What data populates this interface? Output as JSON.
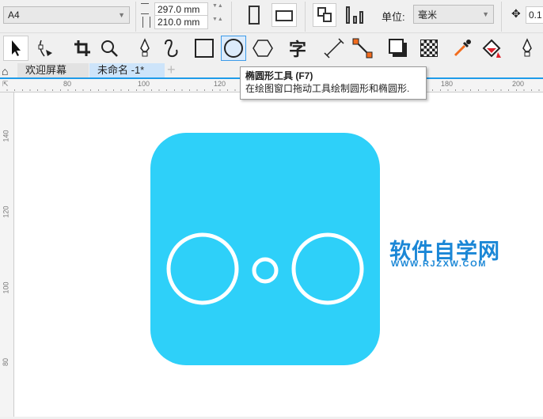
{
  "property_bar": {
    "page_size": "A4",
    "width": "297.0 mm",
    "height": "210.0 mm",
    "units_label": "单位:",
    "units_value": "毫米",
    "nudge": "0.1"
  },
  "toolbox": {
    "tools": [
      {
        "name": "pick-tool",
        "icon": "arrow-cursor-icon"
      },
      {
        "name": "shape-tool",
        "icon": "shape-node-icon"
      },
      {
        "name": "crop-tool",
        "icon": "crop-icon"
      },
      {
        "name": "zoom-tool",
        "icon": "magnifier-icon"
      },
      {
        "name": "freehand-tool",
        "icon": "pen-nib-icon"
      },
      {
        "name": "artistic-media-tool",
        "icon": "curve-icon"
      },
      {
        "name": "rectangle-tool",
        "icon": "rectangle-icon"
      },
      {
        "name": "ellipse-tool",
        "icon": "ellipse-icon",
        "active": true
      },
      {
        "name": "polygon-tool",
        "icon": "hexagon-icon"
      },
      {
        "name": "text-tool",
        "icon": "text-icon",
        "label": "字"
      },
      {
        "name": "dimension-tool",
        "icon": "dimension-icon"
      },
      {
        "name": "connector-tool",
        "icon": "connector-icon"
      },
      {
        "name": "drop-shadow-tool",
        "icon": "shadow-icon"
      },
      {
        "name": "transparency-tool",
        "icon": "checker-icon"
      },
      {
        "name": "eyedropper-tool",
        "icon": "eyedropper-icon"
      },
      {
        "name": "interactive-fill-tool",
        "icon": "fill-icon"
      },
      {
        "name": "smart-fill-tool",
        "icon": "pen-nib-icon"
      }
    ]
  },
  "tabs": [
    {
      "label": "欢迎屏幕"
    },
    {
      "label": "未命名 -1*",
      "active": true
    }
  ],
  "ruler": {
    "h": [
      "80",
      "100",
      "120",
      "180",
      "200"
    ],
    "v": [
      "140",
      "120",
      "100",
      "80"
    ]
  },
  "tooltip": {
    "title": "椭圆形工具 (F7)",
    "body": "在绘图窗口拖动工具绘制圆形和椭圆形."
  },
  "watermark": {
    "title": "软件自学网",
    "url": "WWW.RJZXW.COM"
  },
  "colors": {
    "shape_fill": "#2ed0f9",
    "stroke": "#ffffff",
    "accent": "#1e9be9",
    "watermark": "#1b87d6"
  }
}
